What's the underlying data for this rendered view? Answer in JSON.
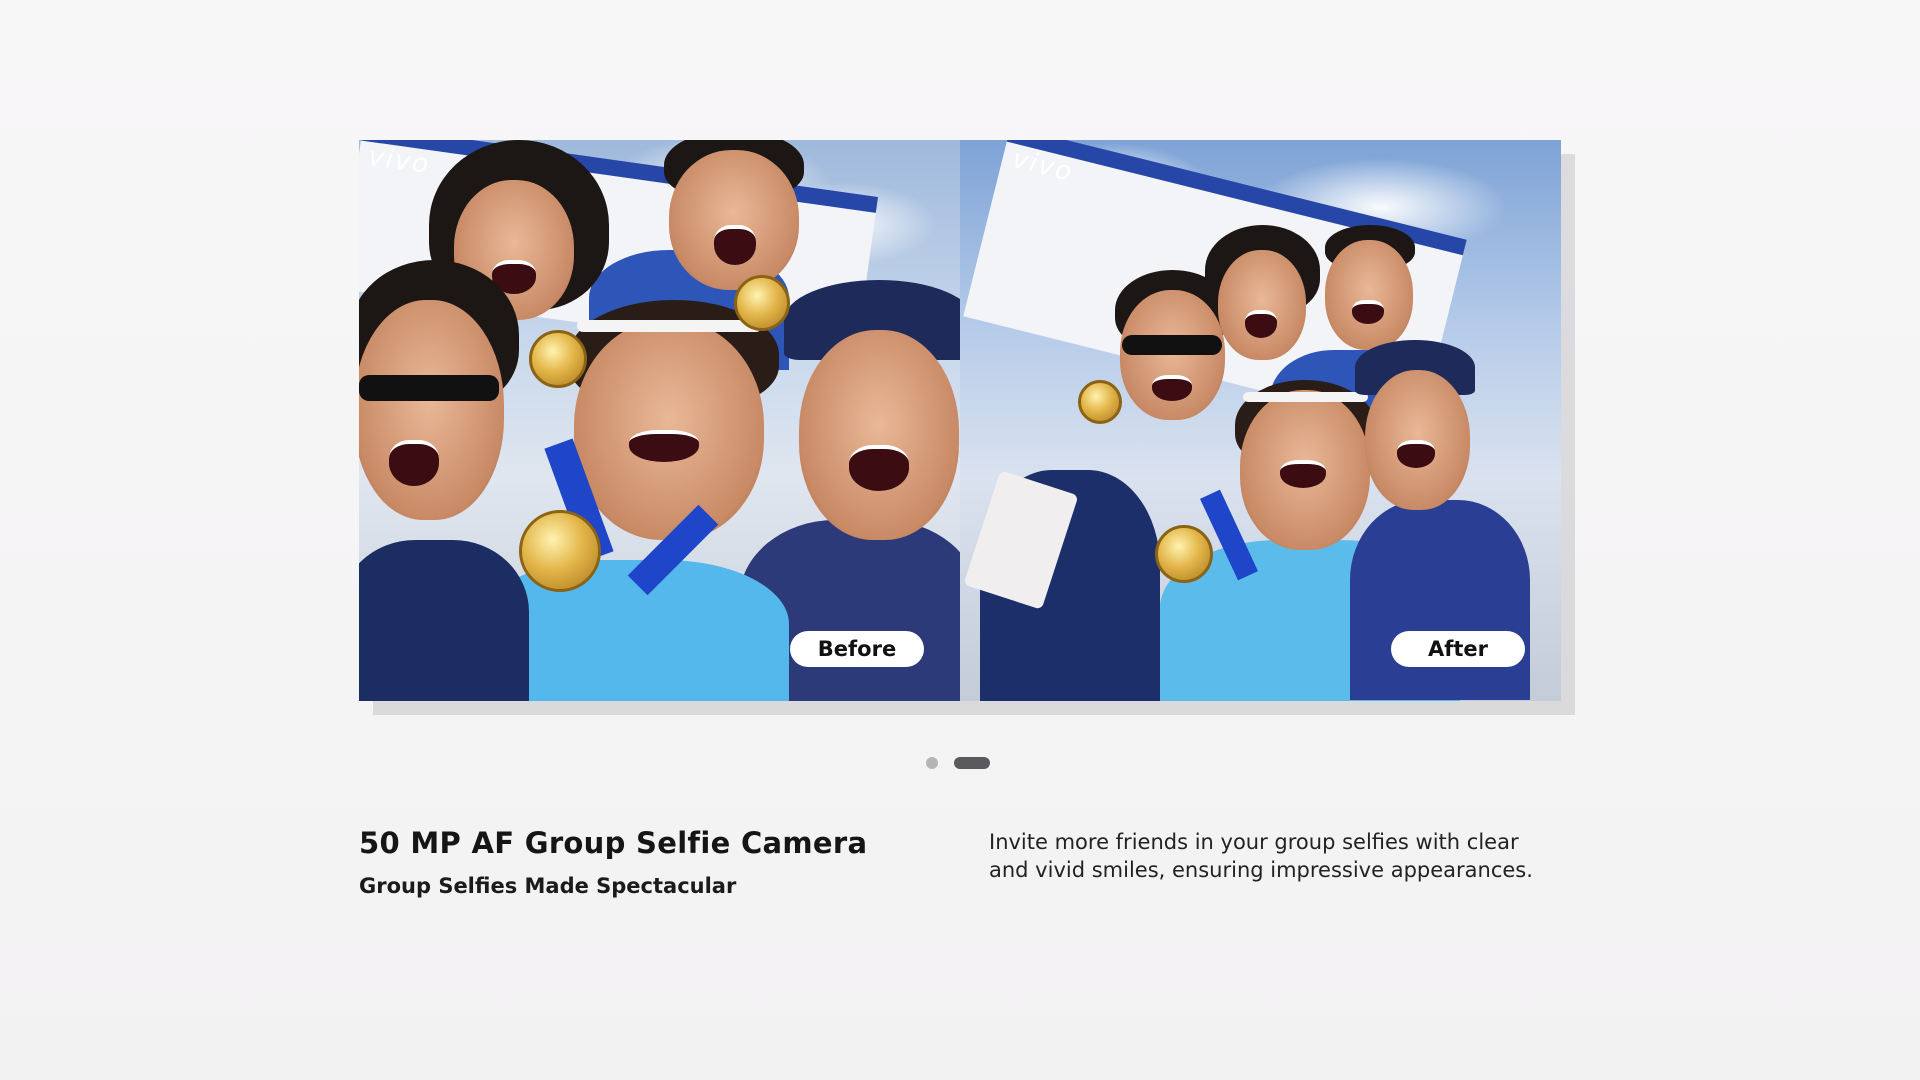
{
  "comparison": {
    "before_label": "Before",
    "after_label": "After",
    "banner_brand": "vivo"
  },
  "pager": {
    "total": 2,
    "active_index": 1
  },
  "feature": {
    "title": "50 MP AF Group Selfie Camera",
    "subtitle": "Group Selfies Made Spectacular",
    "description_lines": [
      "Invite more friends in your group selfies with clear",
      "and vivid smiles, ensuring impressive appearances."
    ]
  },
  "colors": {
    "background": "#f6f5f6",
    "dot_inactive": "#b5b5b8",
    "dot_active": "#5a5a5e",
    "label_pill": "#ffffff"
  }
}
